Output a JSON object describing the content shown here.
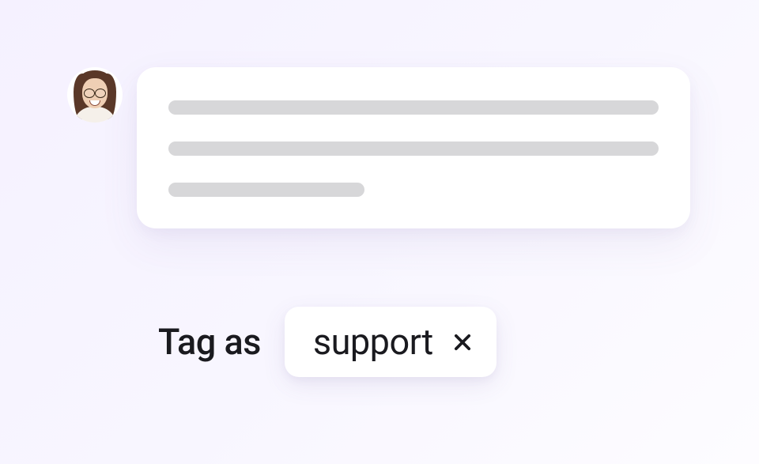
{
  "message": {
    "avatar": "user-avatar",
    "placeholder_lines": [
      "full",
      "full",
      "short"
    ]
  },
  "tag": {
    "prefix_label": "Tag as",
    "value": "support",
    "close_icon": "close-icon"
  }
}
